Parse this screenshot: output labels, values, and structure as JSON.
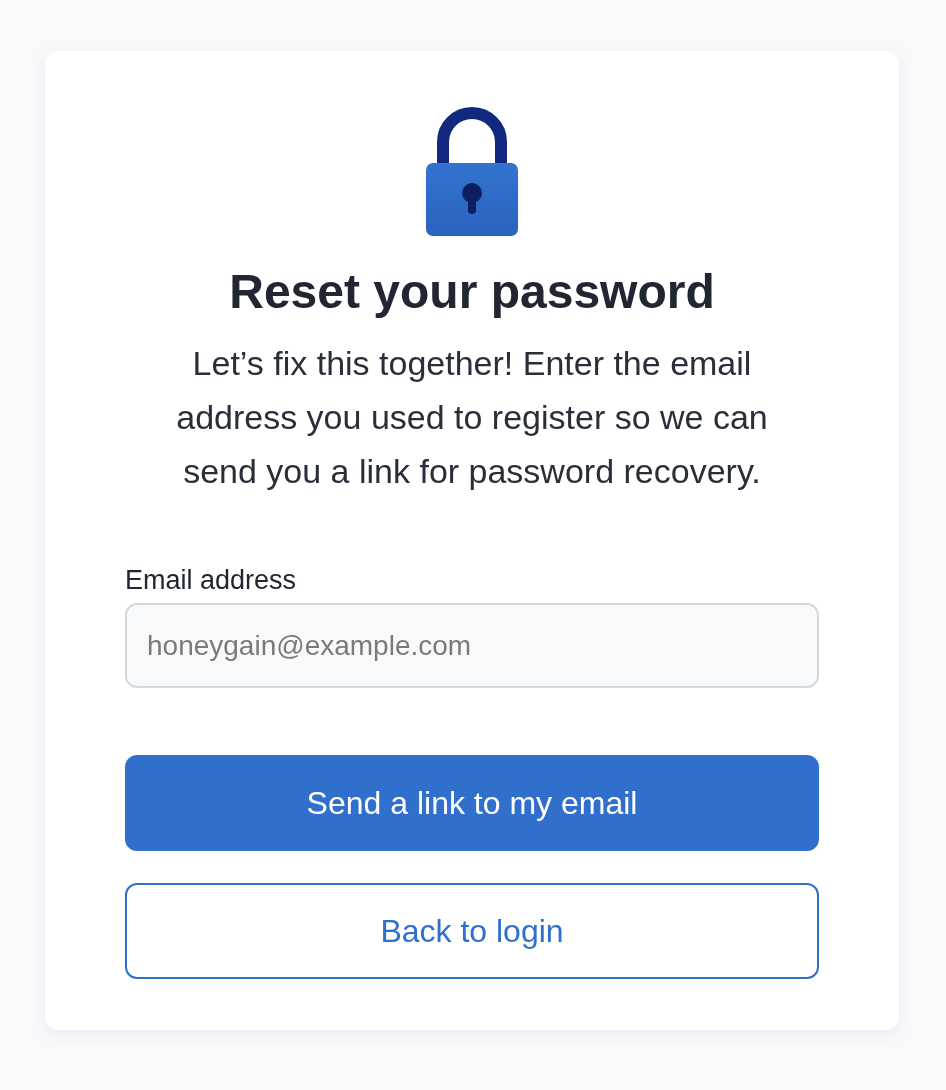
{
  "title": "Reset your password",
  "description": "Let’s fix this together! Enter the email address you used to register so we can send you a link for password recovery.",
  "email_field": {
    "label": "Email address",
    "placeholder": "honeygain@example.com"
  },
  "buttons": [
    {
      "label": "Send a link to my email",
      "kind": "primary"
    },
    {
      "label": "Back to login",
      "kind": "secondary"
    }
  ]
}
